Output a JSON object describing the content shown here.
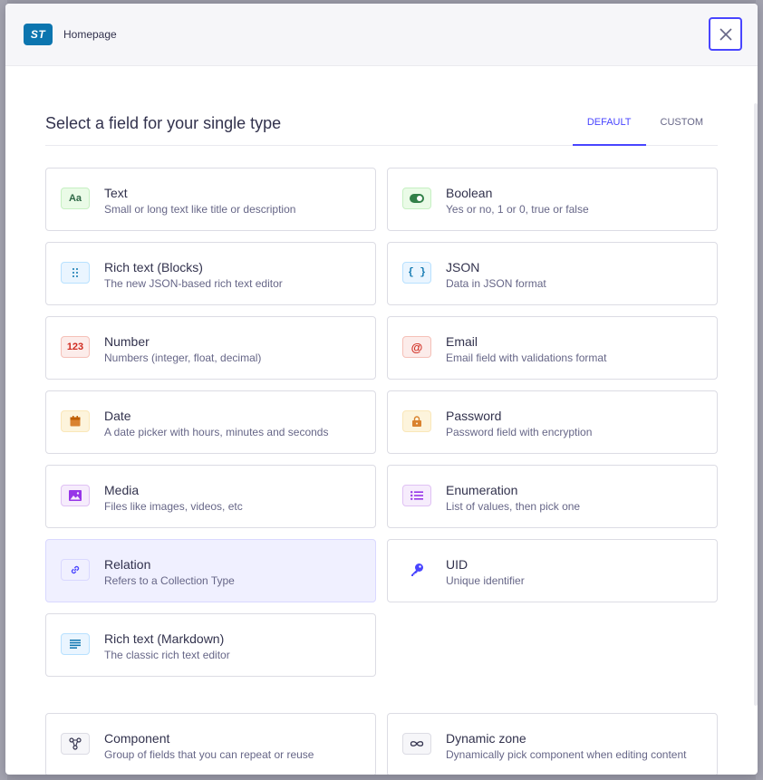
{
  "header": {
    "badge": "ST",
    "title": "Homepage"
  },
  "main": {
    "title": "Select a field for your single type",
    "tabs": [
      {
        "label": "DEFAULT",
        "active": true
      },
      {
        "label": "CUSTOM",
        "active": false
      }
    ]
  },
  "fields": [
    {
      "name": "Text",
      "description": "Small or long text like title or description",
      "icon": "text-icon",
      "glyph": "Aa"
    },
    {
      "name": "Boolean",
      "description": "Yes or no, 1 or 0, true or false",
      "icon": "toggle-icon"
    },
    {
      "name": "Rich text (Blocks)",
      "description": "The new JSON-based rich text editor",
      "icon": "drag-dots-icon"
    },
    {
      "name": "JSON",
      "description": "Data in JSON format",
      "icon": "braces-icon",
      "glyph": "{ }"
    },
    {
      "name": "Number",
      "description": "Numbers (integer, float, decimal)",
      "icon": "number-icon",
      "glyph": "123"
    },
    {
      "name": "Email",
      "description": "Email field with validations format",
      "icon": "at-icon",
      "glyph": "@"
    },
    {
      "name": "Date",
      "description": "A date picker with hours, minutes and seconds",
      "icon": "calendar-icon"
    },
    {
      "name": "Password",
      "description": "Password field with encryption",
      "icon": "lock-icon"
    },
    {
      "name": "Media",
      "description": "Files like images, videos, etc",
      "icon": "image-icon"
    },
    {
      "name": "Enumeration",
      "description": "List of values, then pick one",
      "icon": "list-icon"
    },
    {
      "name": "Relation",
      "description": "Refers to a Collection Type",
      "icon": "link-icon",
      "selected": true
    },
    {
      "name": "UID",
      "description": "Unique identifier",
      "icon": "key-icon"
    },
    {
      "name": "Rich text (Markdown)",
      "description": "The classic rich text editor",
      "icon": "paragraph-icon"
    }
  ],
  "special_fields": [
    {
      "name": "Component",
      "description": "Group of fields that you can repeat or reuse",
      "icon": "component-icon"
    },
    {
      "name": "Dynamic zone",
      "description": "Dynamically pick component when editing content",
      "icon": "infinity-icon"
    }
  ],
  "colors": {
    "primary": "#4945ff",
    "text": "#32324d",
    "muted": "#666687",
    "border": "#dcdce4",
    "selected_bg": "#f0f0ff"
  }
}
